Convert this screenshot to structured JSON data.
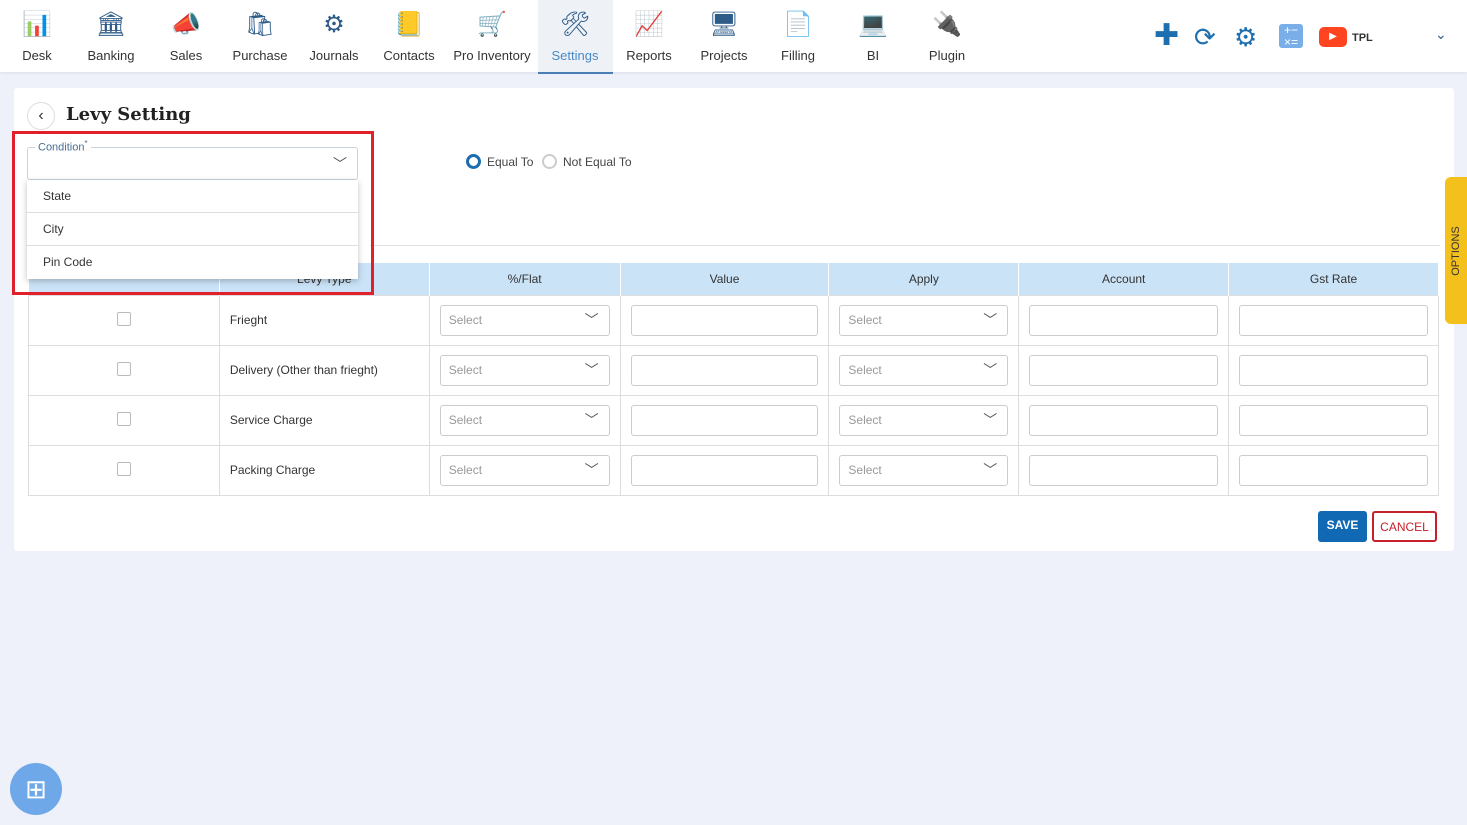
{
  "nav": [
    {
      "label": "Desk",
      "icon": "desk-icon",
      "glyph": "📊"
    },
    {
      "label": "Banking",
      "icon": "bank-icon",
      "glyph": "🏛"
    },
    {
      "label": "Sales",
      "icon": "sales-icon",
      "glyph": "📣"
    },
    {
      "label": "Purchase",
      "icon": "purchase-icon",
      "glyph": "🛍"
    },
    {
      "label": "Journals",
      "icon": "journals-icon",
      "glyph": "⚙"
    },
    {
      "label": "Contacts",
      "icon": "contacts-icon",
      "glyph": "📒"
    },
    {
      "label": "Pro Inventory",
      "icon": "inventory-icon",
      "glyph": "🛒"
    },
    {
      "label": "Settings",
      "icon": "settings-icon",
      "glyph": "🛠"
    },
    {
      "label": "Reports",
      "icon": "reports-icon",
      "glyph": "📈"
    },
    {
      "label": "Projects",
      "icon": "projects-icon",
      "glyph": "🖥"
    },
    {
      "label": "Filling",
      "icon": "filling-icon",
      "glyph": "📄"
    },
    {
      "label": "BI",
      "icon": "bi-icon",
      "glyph": "💻"
    },
    {
      "label": "Plugin",
      "icon": "plugin-icon",
      "glyph": "🔌"
    }
  ],
  "active_nav": "Settings",
  "topright": {
    "company": "TPL"
  },
  "page": {
    "title": "Levy Setting"
  },
  "condition": {
    "label": "Condition",
    "required": "*",
    "options": [
      "State",
      "City",
      "Pin Code"
    ]
  },
  "radios": [
    {
      "label": "Equal To",
      "selected": true
    },
    {
      "label": "Not Equal To",
      "selected": false
    }
  ],
  "table": {
    "headers": [
      "",
      "Levy Type",
      "%/Flat",
      "Value",
      "Apply",
      "Account",
      "Gst Rate"
    ],
    "rows": [
      {
        "levy_type": "Frieght"
      },
      {
        "levy_type": "Delivery (Other than frieght)"
      },
      {
        "levy_type": "Service Charge"
      },
      {
        "levy_type": "Packing Charge"
      }
    ],
    "select_placeholder": "Select"
  },
  "buttons": {
    "save": "SAVE",
    "cancel": "CANCEL"
  },
  "options_tab": "OPTIONS",
  "colors": {
    "accent": "#1168b3",
    "highlight": "#e0202a",
    "header_bg": "#cbe3f7",
    "options": "#f3c01c"
  }
}
